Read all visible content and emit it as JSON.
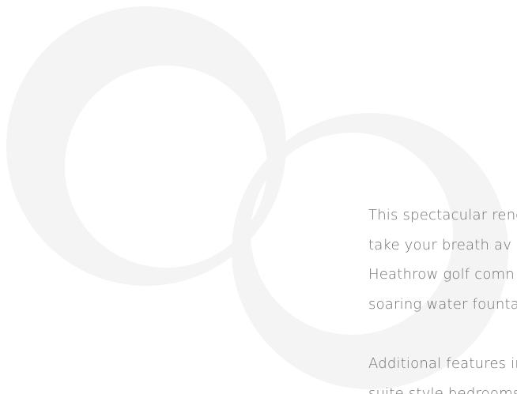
{
  "description": {
    "paragraph1_lines": [
      "This spectacular renc",
      "take your breath av",
      "Heathrow golf comn",
      "soaring water founta"
    ],
    "paragraph2_lines": [
      "Additional features in",
      "suite style bedrooms"
    ]
  },
  "colors": {
    "background": "#ffffff",
    "ring": "#f4f4f4",
    "text": "#6f6f6f"
  }
}
